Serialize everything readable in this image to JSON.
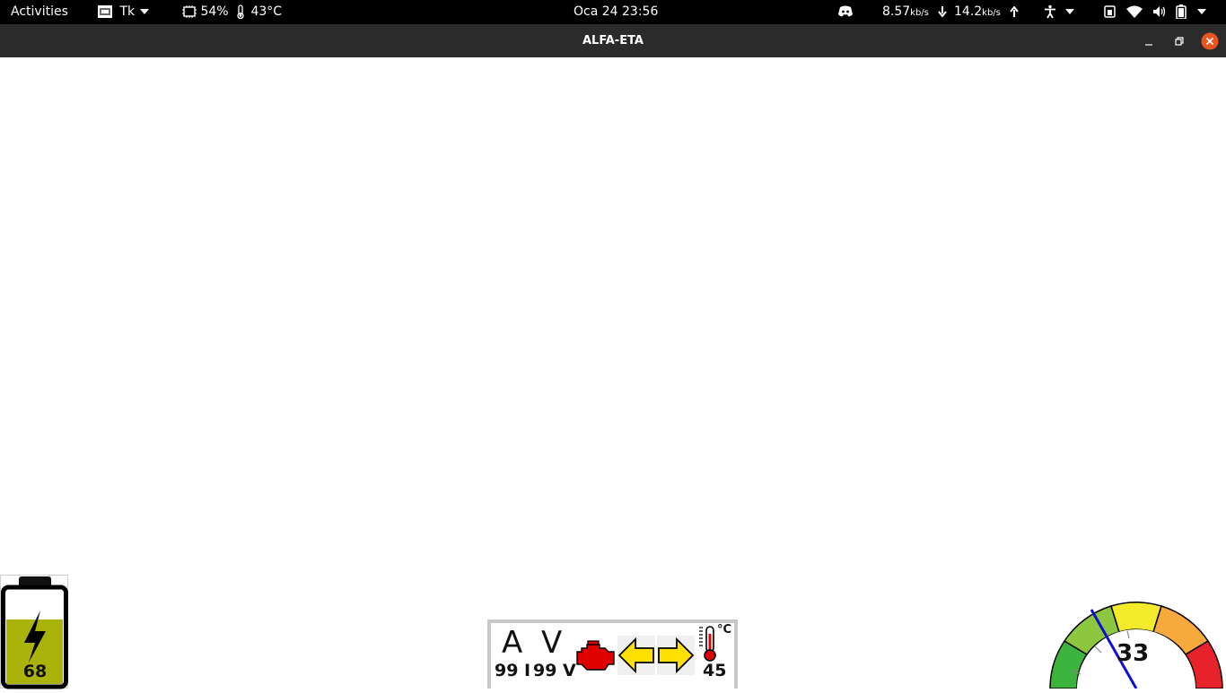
{
  "topbar": {
    "activities": "Activities",
    "app_menu": "Tk",
    "cpu": "54%",
    "temp": "43°C",
    "clock": "Oca 24  23:56",
    "net_down_value": "8.57",
    "net_down_unit": "kb/s",
    "net_up_value": "14.2",
    "net_up_unit": "kb/s"
  },
  "window": {
    "title": "ALFA-ETA"
  },
  "battery": {
    "percent": "68",
    "level": 0.68,
    "fill_color": "#aab30a"
  },
  "dashboard": {
    "current_symbol": "A",
    "voltage_symbol": "V",
    "current_value": "99 I",
    "voltage_value": "99 V",
    "temperature_value": "45",
    "temperature_unit": "°C",
    "engine_color": "#e00000",
    "arrow_color": "#ffe000"
  },
  "speed_gauge": {
    "value": "33"
  }
}
